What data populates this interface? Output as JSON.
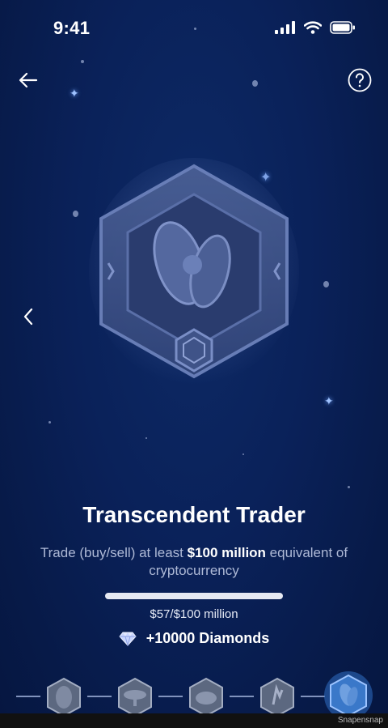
{
  "status_bar": {
    "time": "9:41"
  },
  "achievement": {
    "title": "Transcendent Trader",
    "description_pre": "Trade (buy/sell) at least ",
    "description_bold": "$100 million",
    "description_post": " equivalent of cryptocurrency",
    "progress_text": "$57/$100 million",
    "progress_fraction": 5.7e-07,
    "reward_text": "+10000 Diamonds",
    "reward_icon": "diamond-icon"
  },
  "navigation": {
    "back_icon": "arrow-left-icon",
    "help_icon": "question-circle-icon",
    "prev_icon": "chevron-left-icon"
  },
  "rail": {
    "badges": [
      "badge-1",
      "badge-2",
      "badge-3",
      "badge-4",
      "badge-5-active"
    ]
  },
  "footer": {
    "watermark": "Snapensnap"
  },
  "colors": {
    "background": "#0a2159",
    "accent_badge": "#3a78c9",
    "text_muted": "#aeb9d6"
  }
}
